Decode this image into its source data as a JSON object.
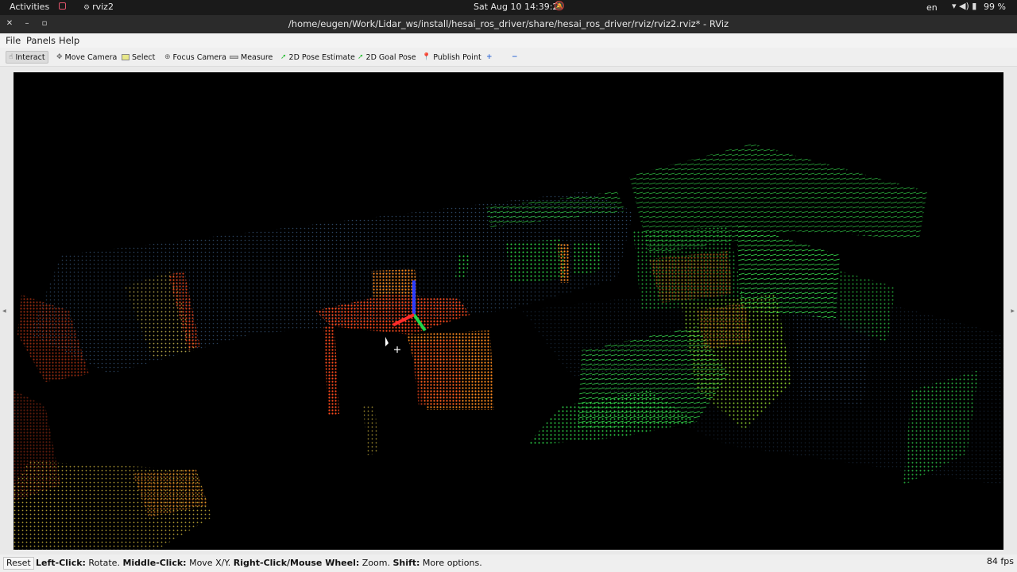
{
  "topbar": {
    "activities": "Activities",
    "app_name": "rviz2",
    "clock": "Sat Aug 10  14:39:28",
    "lang": "en",
    "battery": "99 %"
  },
  "window": {
    "title": "/home/eugen/Work/Lidar_ws/install/hesai_ros_driver/share/hesai_ros_driver/rviz/rviz2.rviz* - RViz"
  },
  "menu": {
    "file": "File",
    "panels": "Panels",
    "help": "Help"
  },
  "toolbar": {
    "interact": "Interact",
    "move_camera": "Move Camera",
    "select": "Select",
    "focus_camera": "Focus Camera",
    "measure": "Measure",
    "pose_estimate": "2D Pose Estimate",
    "goal_pose": "2D Goal Pose",
    "publish_point": "Publish Point"
  },
  "status": {
    "reset": "Reset",
    "hint_left_key": "Left-Click:",
    "hint_left_val": " Rotate. ",
    "hint_mid_key": "Middle-Click:",
    "hint_mid_val": " Move X/Y. ",
    "hint_right_key": "Right-Click/Mouse Wheel:",
    "hint_right_val": " Zoom. ",
    "hint_shift_key": "Shift:",
    "hint_shift_val": " More options.",
    "fps": "84 fps"
  },
  "colors": {
    "near": "#ff3b1a",
    "mid": "#ffb020",
    "far": "#22dd44"
  }
}
